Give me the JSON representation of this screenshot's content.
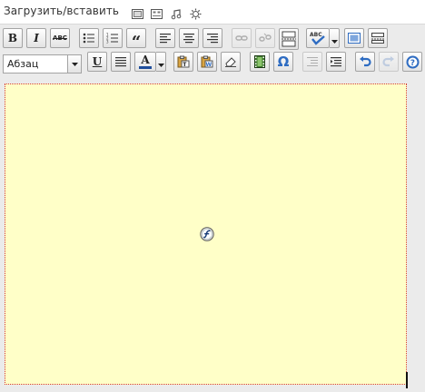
{
  "upload": {
    "label": "Загрузить/вставить",
    "media": [
      {
        "name": "add-image-icon"
      },
      {
        "name": "add-video-icon"
      },
      {
        "name": "add-audio-icon"
      },
      {
        "name": "add-media-icon"
      }
    ]
  },
  "toolbar1": {
    "buttons": [
      {
        "name": "bold-button",
        "glyph": "B"
      },
      {
        "name": "italic-button",
        "glyph": "I"
      },
      {
        "name": "strikethrough-button",
        "glyph": "ABC"
      },
      {
        "name": "bullet-list-button",
        "icon": "unordered-list-icon"
      },
      {
        "name": "numbered-list-button",
        "icon": "ordered-list-icon"
      },
      {
        "name": "blockquote-button",
        "glyph": "“"
      },
      {
        "name": "align-left-button",
        "icon": "align-left-icon"
      },
      {
        "name": "align-center-button",
        "icon": "align-center-icon"
      },
      {
        "name": "align-right-button",
        "icon": "align-right-icon"
      },
      {
        "name": "insert-link-button",
        "icon": "link-icon",
        "disabled": true
      },
      {
        "name": "unlink-button",
        "icon": "unlink-icon",
        "disabled": true
      },
      {
        "name": "insert-more-button",
        "icon": "more-tag-icon"
      },
      {
        "name": "spellcheck-button",
        "glyph": "ABC",
        "icon": "spellcheck-icon"
      },
      {
        "name": "fullscreen-button",
        "icon": "fullscreen-icon"
      },
      {
        "name": "kitchen-sink-button",
        "icon": "kitchen-sink-icon"
      }
    ]
  },
  "toolbar2": {
    "format_select": {
      "value": "Абзац"
    },
    "buttons": [
      {
        "name": "underline-button",
        "glyph": "U"
      },
      {
        "name": "justify-button",
        "icon": "justify-icon"
      },
      {
        "name": "text-color-button",
        "glyph": "A",
        "color": "#1f4e9c"
      },
      {
        "name": "paste-text-button",
        "icon": "paste-text-icon"
      },
      {
        "name": "paste-word-button",
        "icon": "paste-word-icon"
      },
      {
        "name": "remove-format-button",
        "icon": "eraser-icon"
      },
      {
        "name": "insert-media-button",
        "icon": "film-icon"
      },
      {
        "name": "special-char-button",
        "glyph": "Ω"
      },
      {
        "name": "outdent-button",
        "icon": "outdent-icon",
        "disabled": true
      },
      {
        "name": "indent-button",
        "icon": "indent-icon"
      },
      {
        "name": "undo-button",
        "icon": "undo-icon"
      },
      {
        "name": "redo-button",
        "icon": "redo-icon",
        "disabled": true
      },
      {
        "name": "help-button",
        "glyph": "?",
        "icon": "help-icon"
      }
    ]
  },
  "content": {
    "background": "#ffffc8",
    "border_color": "#d43a3a",
    "placeholder_icon": "flash-icon"
  },
  "colors": {
    "accent_blue": "#2e6cc2",
    "toolbar_bg": "#ebebeb"
  }
}
